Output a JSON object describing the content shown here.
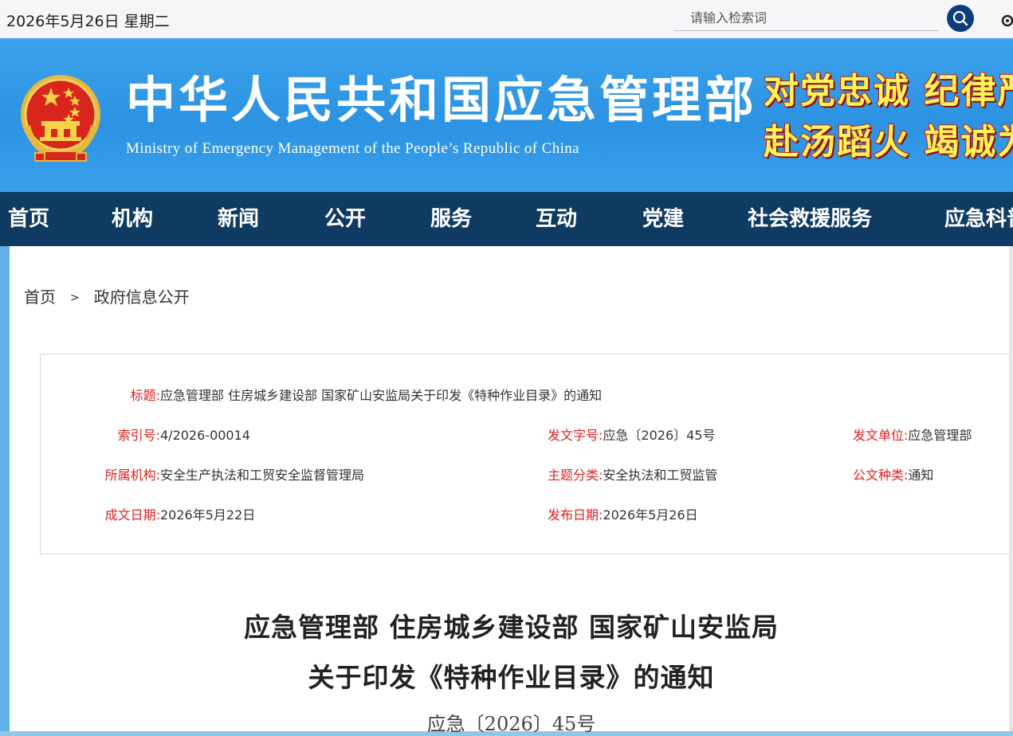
{
  "topbar": {
    "date": "2026年5月26日 星期二",
    "search_placeholder": "请输入检索词"
  },
  "banner": {
    "title": "中华人民共和国应急管理部",
    "subtitle": "Ministry of Emergency Management of the People’s Republic of China",
    "slogan_line1": "对党忠诚 纪律严明",
    "slogan_line2": "赴汤蹈火 竭诚为民"
  },
  "nav": {
    "items": [
      "首页",
      "机构",
      "新闻",
      "公开",
      "服务",
      "互动",
      "党建",
      "社会救援服务",
      "应急科普"
    ]
  },
  "breadcrumb": {
    "home": "首页",
    "separator": ">",
    "current": "政府信息公开"
  },
  "info": {
    "title": {
      "label": "标题:",
      "value": "应急管理部 住房城乡建设部 国家矿山安监局关于印发《特种作业目录》的通知"
    },
    "index_no": {
      "label": "索引号:",
      "value": "4/2026-00014"
    },
    "doc_no": {
      "label": "发文字号:",
      "value": "应急〔2026〕45号"
    },
    "issuer": {
      "label": "发文单位:",
      "value": "应急管理部"
    },
    "agency": {
      "label": "所属机构:",
      "value": "安全生产执法和工贸安全监督管理局"
    },
    "topic": {
      "label": "主题分类:",
      "value": "安全执法和工贸监管"
    },
    "doc_type": {
      "label": "公文种类:",
      "value": "通知"
    },
    "created_date": {
      "label": "成文日期:",
      "value": "2026年5月22日"
    },
    "published_date": {
      "label": "发布日期:",
      "value": "2026年5月26日"
    }
  },
  "document": {
    "title_line1": "应急管理部 住房城乡建设部 国家矿山安监局",
    "title_line2": "关于印发《特种作业目录》的通知",
    "number": "应急〔2026〕45号"
  },
  "colors": {
    "banner_blue": "#2b93e2",
    "nav_dark": "#0f3b62",
    "label_red": "#e21e1e",
    "slogan_yellow": "#fff25a"
  }
}
